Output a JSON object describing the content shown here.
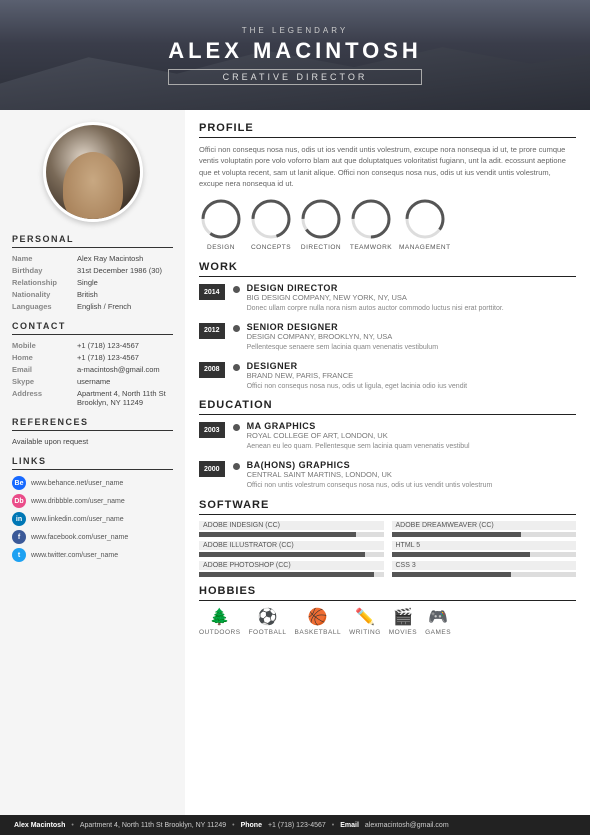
{
  "header": {
    "legendary": "THE LEGENDARY",
    "name": "ALEX MACINTOSH",
    "title": "CREATIVE DIRECTOR"
  },
  "personal": {
    "section": "PERSONAL",
    "fields": [
      {
        "label": "Name",
        "value": "Alex Ray Macintosh"
      },
      {
        "label": "Birthday",
        "value": "31st December 1986 (30)"
      },
      {
        "label": "Relationship",
        "value": "Single"
      },
      {
        "label": "Nationality",
        "value": "British"
      },
      {
        "label": "Languages",
        "value": "English / French"
      }
    ]
  },
  "contact": {
    "section": "CONTACT",
    "fields": [
      {
        "label": "Mobile",
        "value": "+1 (718) 123-4567"
      },
      {
        "label": "Home",
        "value": "+1 (718) 123-4567"
      },
      {
        "label": "Email",
        "value": "a-macintosh@gmail.com"
      },
      {
        "label": "Skype",
        "value": "username"
      },
      {
        "label": "Address",
        "value": "Apartment 4, North 11th St Brooklyn, NY 11249"
      }
    ]
  },
  "references": {
    "section": "REFERENCES",
    "text": "Available upon request"
  },
  "links": {
    "section": "LINKS",
    "items": [
      {
        "platform": "be",
        "label": "Be",
        "url": "www.behance.net/user_name"
      },
      {
        "platform": "dr",
        "label": "Db",
        "url": "www.dribbble.com/user_name"
      },
      {
        "platform": "li",
        "label": "in",
        "url": "www.linkedin.com/user_name"
      },
      {
        "platform": "fb",
        "label": "f",
        "url": "www.facebook.com/user_name"
      },
      {
        "platform": "tw",
        "label": "t",
        "url": "www.twitter.com/user_name"
      }
    ]
  },
  "profile": {
    "section": "PROFILE",
    "text": "Offici non consequs nosa nus, odis ut ios vendit untis volestrum, excupe nora nonsequa id ut, te prore cumque ventis voluptatin pore volo voforro blam aut que doluptatques voloritatist fugiann, unt la adit. ecossunt aeptione que et volupta recent, sam ut lanit alique. Offici non consequs nosa nus, odis ut ius vendit untis volestrum, excupe nera nonsequa id ut."
  },
  "skills": [
    {
      "label": "DESIGN",
      "percent": 85
    },
    {
      "label": "CONCEPTS",
      "percent": 70
    },
    {
      "label": "DIRECTION",
      "percent": 90
    },
    {
      "label": "TEAMWORK",
      "percent": 75
    },
    {
      "label": "MANAGEMENT",
      "percent": 60
    }
  ],
  "work": {
    "section": "WORK",
    "items": [
      {
        "year": "2014",
        "title": "DESIGN DIRECTOR",
        "company": "BIG DESIGN COMPANY, NEW YORK, NY, USA",
        "desc": "Donec ullam corpre nulla nora nism autos auctor commodo luctus nisi erat porttitor."
      },
      {
        "year": "2012",
        "title": "SENIOR DESIGNER",
        "company": "DESIGN COMPANY, BROOKLYN, NY, USA",
        "desc": "Pellentesque senaere sem lacinia quam venenatis vestibulum"
      },
      {
        "year": "2008",
        "title": "DESIGNER",
        "company": "BRAND NEW, PARIS, FRANCE",
        "desc": "Offici non consequs nosa nus, odis ut ligula, eget lacinia odio ius vendit"
      }
    ]
  },
  "education": {
    "section": "EDUCATION",
    "items": [
      {
        "year": "2003",
        "title": "MA GRAPHICS",
        "company": "ROYAL COLLEGE OF ART, LONDON, UK",
        "desc": "Aenean eu leo quam. Pellentesque sem lacinia quam venenatis vestibul"
      },
      {
        "year": "2000",
        "title": "BA(HONS) GRAPHICS",
        "company": "CENTRAL SAINT MARTINS, LONDON, UK",
        "desc": "Offici non untis volestrum consequs nosa nus, odis ut ius vendit untis volestrum"
      }
    ]
  },
  "software": {
    "section": "SOFTWARE",
    "items": [
      {
        "name": "ADOBE INDESIGN (CC)",
        "percent": 85
      },
      {
        "name": "ADOBE DREAMWEAVER (CC)",
        "percent": 70
      },
      {
        "name": "ADOBE ILLUSTRATOR (CC)",
        "percent": 90
      },
      {
        "name": "HTML 5",
        "percent": 75
      },
      {
        "name": "ADOBE PHOTOSHOP (CC)",
        "percent": 95
      },
      {
        "name": "CSS 3",
        "percent": 65
      }
    ]
  },
  "hobbies": {
    "section": "HOBBIES",
    "items": [
      {
        "icon": "🌲",
        "label": "OUTDOORS"
      },
      {
        "icon": "⚽",
        "label": "FOOTBALL"
      },
      {
        "icon": "🏀",
        "label": "BASKETBALL"
      },
      {
        "icon": "✏️",
        "label": "WRITING"
      },
      {
        "icon": "🎬",
        "label": "MOVIES"
      },
      {
        "icon": "🎮",
        "label": "GAMES"
      }
    ]
  },
  "footer": {
    "name": "Alex Macintosh",
    "address": "Apartment 4, North 11th St Brooklyn, NY 11249",
    "phone_label": "Phone",
    "phone": "+1 (718) 123-4567",
    "email_label": "Email",
    "email": "alexmacintosh@gmail.com"
  }
}
